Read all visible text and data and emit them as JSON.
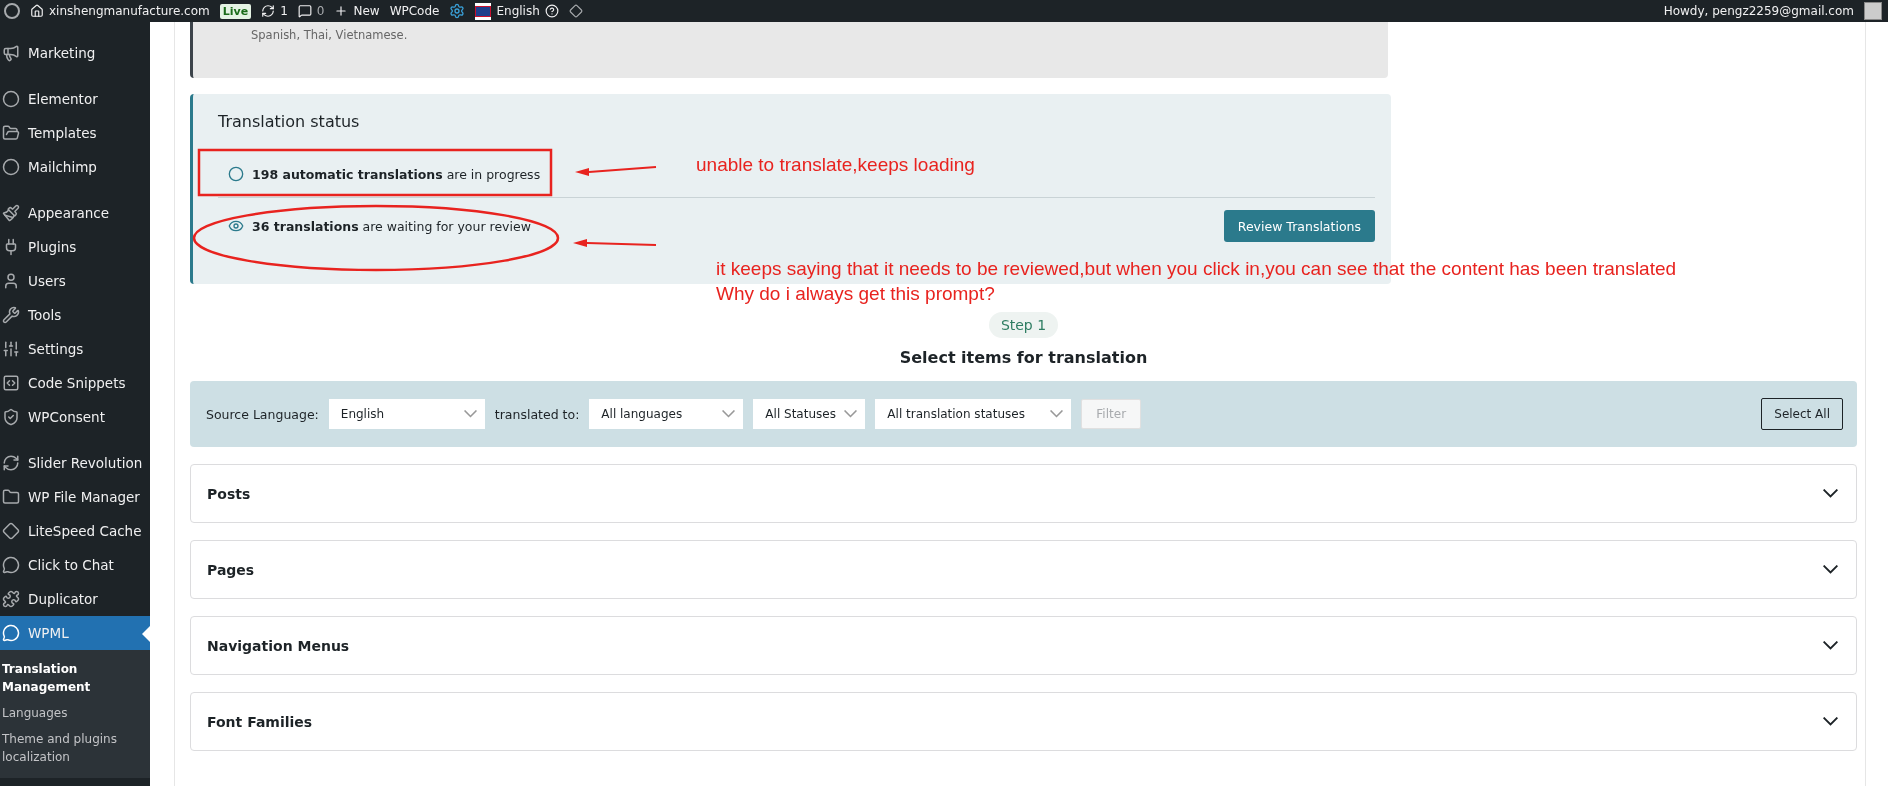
{
  "admin_bar": {
    "site_name": "xinshengmanufacture.com",
    "live_badge": "Live",
    "updates_count": "1",
    "comments_count": "0",
    "new_label": "New",
    "wpcode_label": "WPCode",
    "language": "English",
    "greeting": "Howdy, pengz2259@gmail.com"
  },
  "sidebar": {
    "groups": [
      [
        {
          "label": "Marketing",
          "selected": false
        }
      ],
      [
        {
          "label": "Elementor",
          "selected": false
        },
        {
          "label": "Templates",
          "selected": false
        },
        {
          "label": "Mailchimp",
          "selected": false
        }
      ],
      [
        {
          "label": "Appearance",
          "selected": false
        },
        {
          "label": "Plugins",
          "selected": false
        },
        {
          "label": "Users",
          "selected": false
        },
        {
          "label": "Tools",
          "selected": false
        },
        {
          "label": "Settings",
          "selected": false
        },
        {
          "label": "Code Snippets",
          "selected": false
        },
        {
          "label": "WPConsent",
          "selected": false
        }
      ],
      [
        {
          "label": "Slider Revolution",
          "selected": false
        },
        {
          "label": "WP File Manager",
          "selected": false
        },
        {
          "label": "LiteSpeed Cache",
          "selected": false
        },
        {
          "label": "Click to Chat",
          "selected": false
        },
        {
          "label": "Duplicator",
          "selected": false
        },
        {
          "label": "WPML",
          "selected": true
        }
      ]
    ],
    "submenu": [
      {
        "label": "Translation Management",
        "selected": true
      },
      {
        "label": "Languages",
        "selected": false
      },
      {
        "label": "Theme and plugins localization",
        "selected": false
      }
    ]
  },
  "notice": {
    "text": "Spanish, Thai, Vietnamese."
  },
  "translation_status": {
    "title": "Translation status",
    "rows": [
      {
        "kind": "progress",
        "bold": "198 automatic translations",
        "rest": "are in progress"
      },
      {
        "kind": "review",
        "bold": "36 translations",
        "rest": "are waiting for your review",
        "button": "Review Translations"
      }
    ]
  },
  "annotations": [
    {
      "lines": [
        "unable to translate,keeps loading"
      ]
    },
    {
      "lines": [
        "it keeps saying that it needs to be reviewed,but when you click in,you can see that the content has been translated",
        "Why do i always get this prompt?"
      ]
    }
  ],
  "step": "Step 1",
  "heading": "Select items for translation",
  "filters": {
    "source_label": "Source Language:",
    "source_value": "English",
    "target_label": "translated to:",
    "target_value": "All languages",
    "status_value": "All Statuses",
    "translation_status_value": "All translation statuses",
    "filter_button": "Filter",
    "select_all_button": "Select All"
  },
  "sections": [
    {
      "label": "Posts",
      "expanded": false
    },
    {
      "label": "Pages",
      "expanded": false
    },
    {
      "label": "Navigation Menus",
      "expanded": false
    },
    {
      "label": "Font Families",
      "expanded": false
    }
  ]
}
